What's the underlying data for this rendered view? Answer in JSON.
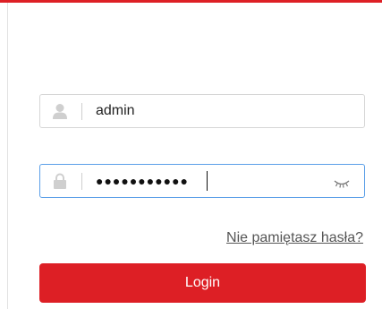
{
  "login_form": {
    "username": {
      "value": "admin",
      "icon": "user-icon"
    },
    "password": {
      "masked_value": "●●●●●●●●●●●",
      "lock_icon": "lock-icon",
      "toggle_icon": "eye-closed-icon"
    },
    "forgot_password_label": "Nie pamiętasz hasła?",
    "login_label": "Login"
  },
  "colors": {
    "accent": "#dd1f25",
    "focus_border": "#5b9fe8",
    "field_border": "#d6d6d6"
  }
}
